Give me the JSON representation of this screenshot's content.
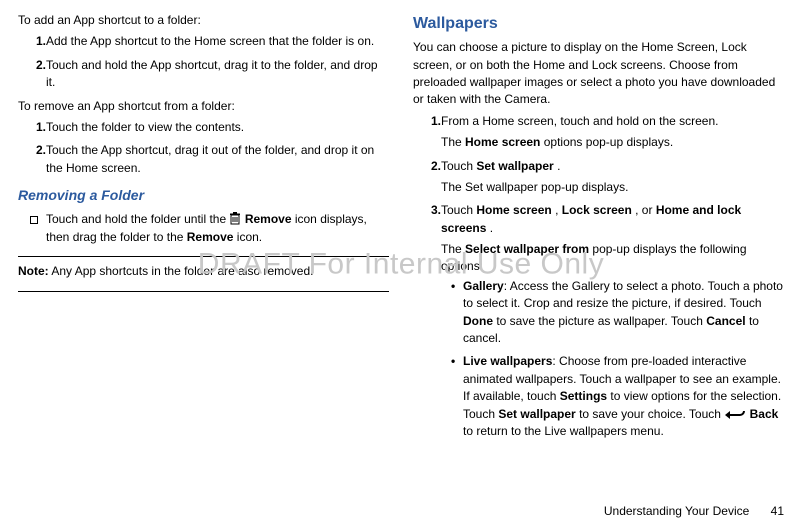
{
  "watermark": "DRAFT For Internal Use Only",
  "left": {
    "intro_add": "To add an App shortcut to a folder:",
    "add_step1_num": "1.",
    "add_step1": "Add the App shortcut to the Home screen that the folder is on.",
    "add_step2_num": "2.",
    "add_step2": "Touch and hold the App shortcut, drag it to the folder, and drop it.",
    "intro_remove": "To remove an App shortcut from a folder:",
    "rem_step1_num": "1.",
    "rem_step1": "Touch the folder to view the contents.",
    "rem_step2_num": "2.",
    "rem_step2": "Touch the App shortcut, drag it out of the folder, and drop it on the Home screen.",
    "heading_removefolder": "Removing a Folder",
    "bullet_pre": "Touch and hold the folder until the ",
    "bullet_remove_label": "Remove",
    "bullet_post1": " icon displays, then drag the folder to the ",
    "bullet_post2": " icon.",
    "note_label": "Note:",
    "note_text": " Any App shortcuts in the folder are also removed."
  },
  "right": {
    "heading_wallpapers": "Wallpapers",
    "intro": "You can choose a picture to display on the Home Screen, Lock screen, or on both the Home and Lock screens. Choose from preloaded wallpaper images or select a photo you have downloaded or taken with the Camera.",
    "s1_num": "1.",
    "s1": "From a Home screen, touch and hold on the screen.",
    "s1b_pre": "The ",
    "s1b_bold": "Home screen",
    "s1b_post": " options pop-up displays.",
    "s2_num": "2.",
    "s2_pre": "Touch ",
    "s2_bold": "Set wallpaper",
    "s2_post": ".",
    "s2b": "The Set wallpaper pop-up displays.",
    "s3_num": "3.",
    "s3_pre": "Touch ",
    "s3_b1": "Home screen",
    "s3_sep1": ", ",
    "s3_b2": "Lock screen",
    "s3_sep2": ", or ",
    "s3_b3": "Home and lock screens",
    "s3_post": ".",
    "s3b_pre": "The ",
    "s3b_bold": "Select wallpaper from",
    "s3b_post": " pop-up displays the following options:",
    "opt1_label": "Gallery",
    "opt1_t1": ": Access the Gallery to select a photo. Touch a photo to select it. Crop and resize the picture, if desired. Touch ",
    "opt1_b1": "Done",
    "opt1_t2": " to save the picture as wallpaper. Touch ",
    "opt1_b2": "Cancel",
    "opt1_t3": " to cancel.",
    "opt2_label": "Live wallpapers",
    "opt2_t1": ": Choose from pre-loaded interactive animated wallpapers. Touch a wallpaper to see an example. If available, touch ",
    "opt2_b1": "Settings",
    "opt2_t2": " to view options for the selection. Touch ",
    "opt2_b2": "Set wallpaper",
    "opt2_t3": " to save your choice. Touch ",
    "opt2_b3": "Back",
    "opt2_t4": " to return to the Live wallpapers menu."
  },
  "footer": {
    "section": "Understanding Your Device",
    "page": "41"
  }
}
